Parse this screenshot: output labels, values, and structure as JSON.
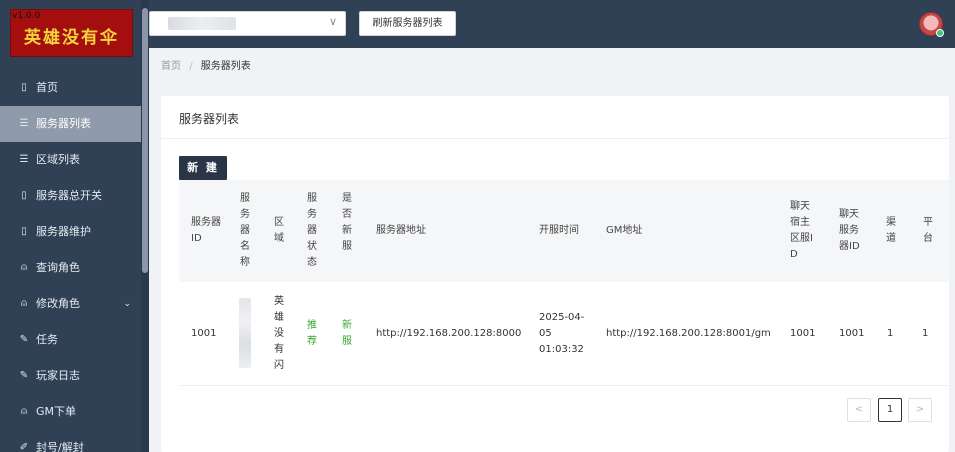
{
  "logo": {
    "version": "v1.0.0",
    "text": "英雄没有伞"
  },
  "sidebar": {
    "items": [
      {
        "label": "首页",
        "icon": "page-icon"
      },
      {
        "label": "服务器列表",
        "icon": "list-icon",
        "active": true
      },
      {
        "label": "区域列表",
        "icon": "list-icon"
      },
      {
        "label": "服务器总开关",
        "icon": "page-icon"
      },
      {
        "label": "服务器维护",
        "icon": "page-icon"
      },
      {
        "label": "查询角色",
        "icon": "user-icon"
      },
      {
        "label": "修改角色",
        "icon": "user-icon",
        "has_submenu": true
      },
      {
        "label": "任务",
        "icon": "wrench-icon"
      },
      {
        "label": "玩家日志",
        "icon": "wrench-icon"
      },
      {
        "label": "GM下单",
        "icon": "user-icon"
      },
      {
        "label": "封号/解封",
        "icon": "edit-icon"
      }
    ]
  },
  "header": {
    "refresh_label": "刷新服务器列表",
    "select_caret": "∨"
  },
  "breadcrumb": {
    "home": "首页",
    "separator": "/",
    "current": "服务器列表"
  },
  "card": {
    "title": "服务器列表",
    "new_label": "新 建"
  },
  "table": {
    "headers": {
      "id": "服务器ID",
      "name": "服务器名称",
      "region": "区域",
      "status": "服务器状态",
      "is_new": "是否新服",
      "address": "服务器地址",
      "open_time": "开服时间",
      "gm_address": "GM地址",
      "chat_host": "聊天宿主区服ID",
      "chat_server": "聊天服务器ID",
      "channel": "渠道",
      "platform": "平台"
    },
    "rows": [
      {
        "id": "1001",
        "region": "英雄没有闪",
        "status": "推荐",
        "is_new": "新服",
        "address": "http://192.168.200.128:8000",
        "open_time": "2025-04-05 01:03:32",
        "gm_address": "http://192.168.200.128:8001/gm",
        "chat_host": "1001",
        "chat_server": "1001",
        "channel": "1",
        "platform": "1"
      }
    ]
  },
  "pagination": {
    "prev": "<",
    "current_page": "1",
    "next": ">"
  }
}
